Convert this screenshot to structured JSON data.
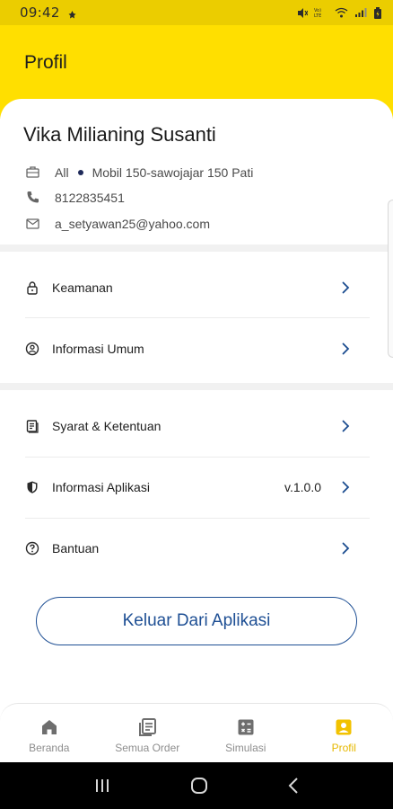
{
  "status_bar": {
    "time": "09:42",
    "battery_color": "#2b2b2b"
  },
  "app_bar": {
    "title": "Profil",
    "color": "#ffdf00"
  },
  "profile": {
    "name": "Vika Milianing Susanti",
    "category": "All",
    "vehicle": "Mobil 150-sawojajar 150 Pati",
    "phone": "8122835451",
    "email": "a_setyawan25@yahoo.com"
  },
  "menu": {
    "group1": [
      {
        "label": "Keamanan",
        "icon": "lock-icon"
      },
      {
        "label": "Informasi Umum",
        "icon": "user-circle-icon"
      }
    ],
    "group2": [
      {
        "label": "Syarat & Ketentuan",
        "icon": "document-icon"
      },
      {
        "label": "Informasi Aplikasi",
        "icon": "shield-icon",
        "value": "v.1.0.0"
      },
      {
        "label": "Bantuan",
        "icon": "help-icon"
      }
    ]
  },
  "logout_label": "Keluar Dari Aplikasi",
  "bottom_nav": [
    {
      "label": "Beranda",
      "icon": "home-icon"
    },
    {
      "label": "Semua Order",
      "icon": "orders-icon"
    },
    {
      "label": "Simulasi",
      "icon": "calculator-icon"
    },
    {
      "label": "Profil",
      "icon": "profile-icon",
      "active": true
    }
  ],
  "colors": {
    "accent_yellow": "#ffdf00",
    "link_blue": "#1e4f94",
    "active_nav": "#f2c200"
  }
}
